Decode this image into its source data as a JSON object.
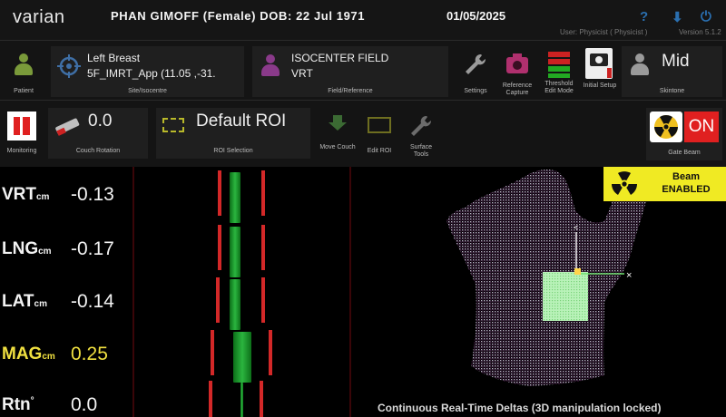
{
  "app": {
    "logo": "varian",
    "patient_header": "PHAN GIMOFF (Female) DOB: 22 Jul 1971",
    "date_header": "01/05/2025",
    "user": "User: Physicist ( Physicist )",
    "version": "Version 5.1.2"
  },
  "toolbar": {
    "patient_label": "Patient",
    "site_line1": "Left Breast",
    "site_line2": "5F_IMRT_App (11.05 ,-31.",
    "site_caption": "Site/Isocentre",
    "field_line1": "ISOCENTER FIELD",
    "field_line2": "VRT",
    "field_caption": "Field/Reference",
    "settings_label": "Settings",
    "reference_capture_label": "Reference Capture",
    "threshold_label": "Threshold Edit Mode",
    "initial_setup_label": "Initial Setup",
    "skintone_value": "Mid",
    "skintone_label": "Skintone"
  },
  "row2": {
    "monitoring_label": "Monitoring",
    "couch_rotation_value": "0.0",
    "couch_rotation_label": "Couch Rotation",
    "roi_value": "Default ROI",
    "roi_label": "ROI Selection",
    "move_couch_label": "Move Couch",
    "edit_roi_label": "Edit ROI",
    "surface_tools_label": "Surface Tools",
    "gate_state": "ON",
    "gate_label": "Gate Beam"
  },
  "readouts": [
    {
      "label": "VRT",
      "unit": "cm",
      "value": "-0.13",
      "highlight": false,
      "bar_center": -0.13
    },
    {
      "label": "LNG",
      "unit": "cm",
      "value": "-0.17",
      "highlight": false,
      "bar_center": -0.17
    },
    {
      "label": "LAT",
      "unit": "cm",
      "value": "-0.14",
      "highlight": false,
      "bar_center": -0.14
    },
    {
      "label": "MAG",
      "unit": "cm",
      "value": "0.25",
      "highlight": true,
      "bar_center": 0.25
    },
    {
      "label": "Rtn",
      "unit": "°",
      "value": "0.0",
      "highlight": false,
      "bar_center": 0.0
    }
  ],
  "beam": {
    "line1": "Beam",
    "line2": "ENABLED"
  },
  "view_caption": "Continuous Real-Time Deltas (3D manipulation locked)",
  "colors": {
    "accent_red": "#d32828",
    "bar_green": "#2bb53f",
    "beam_yellow": "#f0ea23",
    "on_red": "#e02020",
    "mag_yellow": "#f0e040"
  }
}
